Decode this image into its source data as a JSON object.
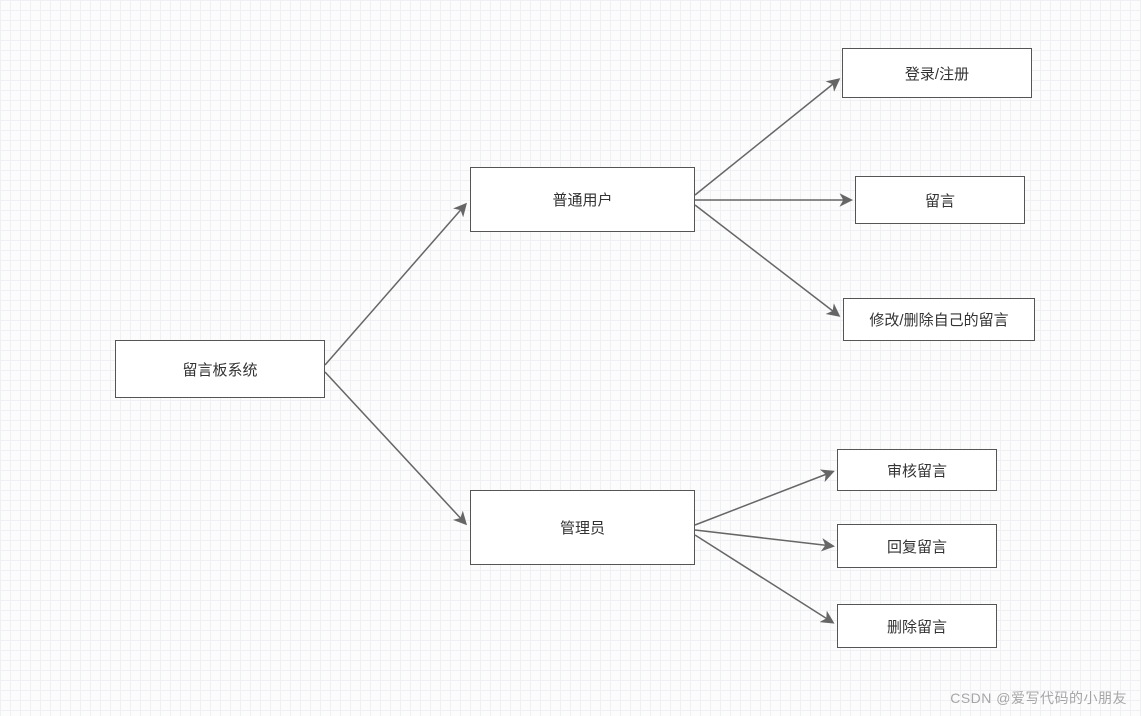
{
  "diagram": {
    "root": {
      "label": "留言板系统"
    },
    "level2": {
      "normalUser": {
        "label": "普通用户"
      },
      "admin": {
        "label": "管理员"
      }
    },
    "normalUserActions": {
      "loginRegister": {
        "label": "登录/注册"
      },
      "postMessage": {
        "label": "留言"
      },
      "editDeleteOwn": {
        "label": "修改/删除自己的留言"
      }
    },
    "adminActions": {
      "reviewMessage": {
        "label": "审核留言"
      },
      "replyMessage": {
        "label": "回复留言"
      },
      "deleteMessage": {
        "label": "删除留言"
      }
    }
  },
  "watermark": "CSDN @爱写代码的小朋友",
  "colors": {
    "nodeBorder": "#555555",
    "nodeBg": "#ffffff",
    "arrowStroke": "#666666",
    "gridMinor": "#eef0f4",
    "gridMajor": "#e4e7ec"
  }
}
